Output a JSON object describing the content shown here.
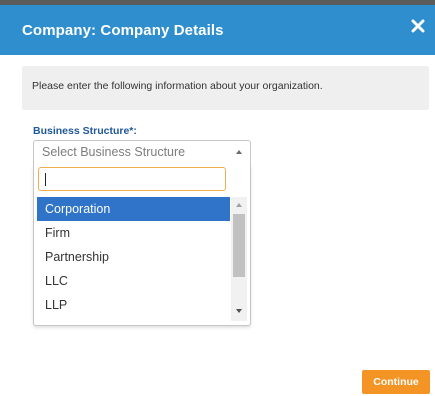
{
  "dialog": {
    "title": "Company: Company Details",
    "close_icon": "close-x-icon"
  },
  "info": {
    "text": "Please enter the following information about your organization."
  },
  "form": {
    "business_structure": {
      "label": "Business Structure*:",
      "placeholder": "Select Business Structure",
      "search_value": "",
      "options": [
        "Corporation",
        "Firm",
        "Partnership",
        "LLC",
        "LLP"
      ],
      "highlighted": "Corporation"
    }
  },
  "footer": {
    "continue_label": "Continue"
  },
  "colors": {
    "header": "#2f8ece",
    "label": "#20589b",
    "highlight": "#2f74c9",
    "search_border": "#f0ad4e",
    "continue": "#f39424"
  }
}
